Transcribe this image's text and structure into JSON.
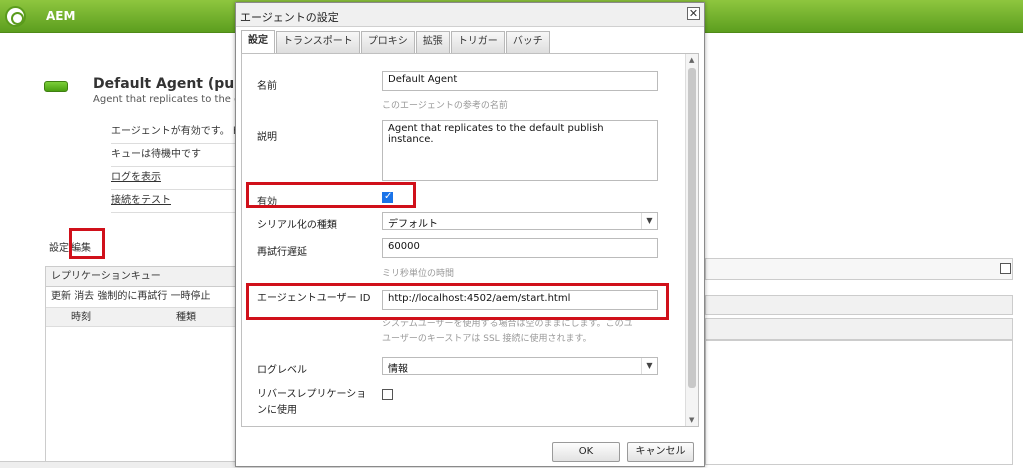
{
  "app": {
    "title": "AEM"
  },
  "agent": {
    "title": "Default Agent (publish",
    "desc": "Agent that replicates to the defau",
    "status": [
      {
        "label": "エージェントが有効です。 h",
        "link": false
      },
      {
        "label": "キューは待機中です",
        "link": false
      },
      {
        "label": "ログを表示",
        "link": true
      },
      {
        "label": "接続をテスト",
        "link": true
      }
    ],
    "tabs": [
      "設定",
      "編集"
    ]
  },
  "queue": {
    "title": "レプリケーションキュー",
    "tools": [
      "更新",
      "消去",
      "強制的に再試行",
      "一時停止"
    ],
    "cols": [
      "時刻",
      "種類"
    ]
  },
  "dialog": {
    "title": "エージェントの設定",
    "close": "✕",
    "tabs": [
      "設定",
      "トランスポート",
      "プロキシ",
      "拡張",
      "トリガー",
      "バッチ"
    ],
    "fields": {
      "name_label": "名前",
      "name_value": "Default Agent",
      "name_hint": "このエージェントの参考の名前",
      "desc_label": "説明",
      "desc_value": "Agent that replicates to the default publish instance.",
      "enabled_label": "有効",
      "enabled": true,
      "serial_label": "シリアル化の種類",
      "serial_value": "デフォルト",
      "retry_label": "再試行遅延",
      "retry_value": "60000",
      "retry_hint": "ミリ秒単位の時間",
      "user_label": "エージェントユーザー ID",
      "user_value": "http://localhost:4502/aem/start.html",
      "user_hint1": "システムユーザーを使用する場合は空のままにします。このユ",
      "user_hint2": "ユーザーのキーストアは SSL 接続に使用されます。",
      "log_label": "ログレベル",
      "log_value": "情報",
      "reverse_label": "リバースレプリケーションに使用",
      "reverse": false
    },
    "ok": "OK",
    "cancel": "キャンセル"
  },
  "colors": {
    "accent_green": "#6aab2a",
    "highlight_red": "#d0101a",
    "checkbox_blue": "#1a73e8"
  }
}
